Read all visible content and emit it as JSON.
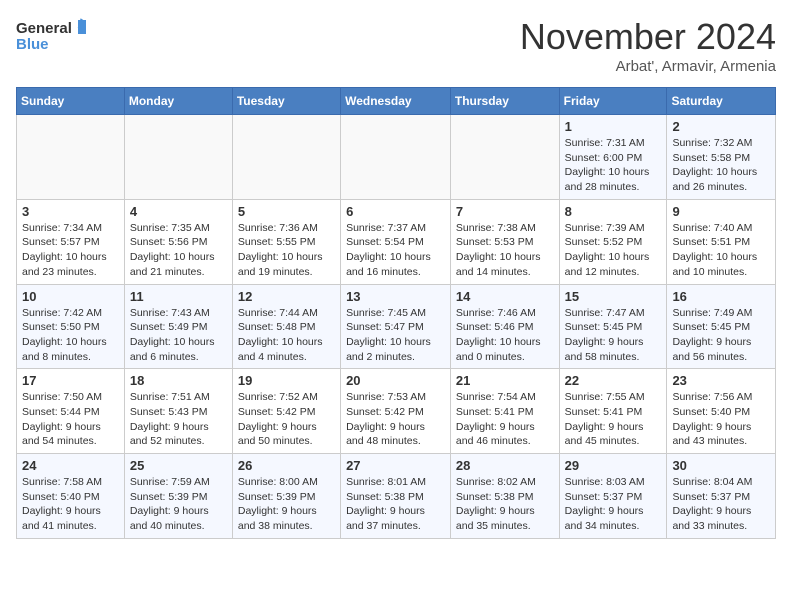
{
  "logo": {
    "line1": "General",
    "line2": "Blue"
  },
  "title": "November 2024",
  "location": "Arbat', Armavir, Armenia",
  "weekdays": [
    "Sunday",
    "Monday",
    "Tuesday",
    "Wednesday",
    "Thursday",
    "Friday",
    "Saturday"
  ],
  "weeks": [
    [
      {
        "day": "",
        "info": ""
      },
      {
        "day": "",
        "info": ""
      },
      {
        "day": "",
        "info": ""
      },
      {
        "day": "",
        "info": ""
      },
      {
        "day": "",
        "info": ""
      },
      {
        "day": "1",
        "info": "Sunrise: 7:31 AM\nSunset: 6:00 PM\nDaylight: 10 hours and 28 minutes."
      },
      {
        "day": "2",
        "info": "Sunrise: 7:32 AM\nSunset: 5:58 PM\nDaylight: 10 hours and 26 minutes."
      }
    ],
    [
      {
        "day": "3",
        "info": "Sunrise: 7:34 AM\nSunset: 5:57 PM\nDaylight: 10 hours and 23 minutes."
      },
      {
        "day": "4",
        "info": "Sunrise: 7:35 AM\nSunset: 5:56 PM\nDaylight: 10 hours and 21 minutes."
      },
      {
        "day": "5",
        "info": "Sunrise: 7:36 AM\nSunset: 5:55 PM\nDaylight: 10 hours and 19 minutes."
      },
      {
        "day": "6",
        "info": "Sunrise: 7:37 AM\nSunset: 5:54 PM\nDaylight: 10 hours and 16 minutes."
      },
      {
        "day": "7",
        "info": "Sunrise: 7:38 AM\nSunset: 5:53 PM\nDaylight: 10 hours and 14 minutes."
      },
      {
        "day": "8",
        "info": "Sunrise: 7:39 AM\nSunset: 5:52 PM\nDaylight: 10 hours and 12 minutes."
      },
      {
        "day": "9",
        "info": "Sunrise: 7:40 AM\nSunset: 5:51 PM\nDaylight: 10 hours and 10 minutes."
      }
    ],
    [
      {
        "day": "10",
        "info": "Sunrise: 7:42 AM\nSunset: 5:50 PM\nDaylight: 10 hours and 8 minutes."
      },
      {
        "day": "11",
        "info": "Sunrise: 7:43 AM\nSunset: 5:49 PM\nDaylight: 10 hours and 6 minutes."
      },
      {
        "day": "12",
        "info": "Sunrise: 7:44 AM\nSunset: 5:48 PM\nDaylight: 10 hours and 4 minutes."
      },
      {
        "day": "13",
        "info": "Sunrise: 7:45 AM\nSunset: 5:47 PM\nDaylight: 10 hours and 2 minutes."
      },
      {
        "day": "14",
        "info": "Sunrise: 7:46 AM\nSunset: 5:46 PM\nDaylight: 10 hours and 0 minutes."
      },
      {
        "day": "15",
        "info": "Sunrise: 7:47 AM\nSunset: 5:45 PM\nDaylight: 9 hours and 58 minutes."
      },
      {
        "day": "16",
        "info": "Sunrise: 7:49 AM\nSunset: 5:45 PM\nDaylight: 9 hours and 56 minutes."
      }
    ],
    [
      {
        "day": "17",
        "info": "Sunrise: 7:50 AM\nSunset: 5:44 PM\nDaylight: 9 hours and 54 minutes."
      },
      {
        "day": "18",
        "info": "Sunrise: 7:51 AM\nSunset: 5:43 PM\nDaylight: 9 hours and 52 minutes."
      },
      {
        "day": "19",
        "info": "Sunrise: 7:52 AM\nSunset: 5:42 PM\nDaylight: 9 hours and 50 minutes."
      },
      {
        "day": "20",
        "info": "Sunrise: 7:53 AM\nSunset: 5:42 PM\nDaylight: 9 hours and 48 minutes."
      },
      {
        "day": "21",
        "info": "Sunrise: 7:54 AM\nSunset: 5:41 PM\nDaylight: 9 hours and 46 minutes."
      },
      {
        "day": "22",
        "info": "Sunrise: 7:55 AM\nSunset: 5:41 PM\nDaylight: 9 hours and 45 minutes."
      },
      {
        "day": "23",
        "info": "Sunrise: 7:56 AM\nSunset: 5:40 PM\nDaylight: 9 hours and 43 minutes."
      }
    ],
    [
      {
        "day": "24",
        "info": "Sunrise: 7:58 AM\nSunset: 5:40 PM\nDaylight: 9 hours and 41 minutes."
      },
      {
        "day": "25",
        "info": "Sunrise: 7:59 AM\nSunset: 5:39 PM\nDaylight: 9 hours and 40 minutes."
      },
      {
        "day": "26",
        "info": "Sunrise: 8:00 AM\nSunset: 5:39 PM\nDaylight: 9 hours and 38 minutes."
      },
      {
        "day": "27",
        "info": "Sunrise: 8:01 AM\nSunset: 5:38 PM\nDaylight: 9 hours and 37 minutes."
      },
      {
        "day": "28",
        "info": "Sunrise: 8:02 AM\nSunset: 5:38 PM\nDaylight: 9 hours and 35 minutes."
      },
      {
        "day": "29",
        "info": "Sunrise: 8:03 AM\nSunset: 5:37 PM\nDaylight: 9 hours and 34 minutes."
      },
      {
        "day": "30",
        "info": "Sunrise: 8:04 AM\nSunset: 5:37 PM\nDaylight: 9 hours and 33 minutes."
      }
    ]
  ]
}
